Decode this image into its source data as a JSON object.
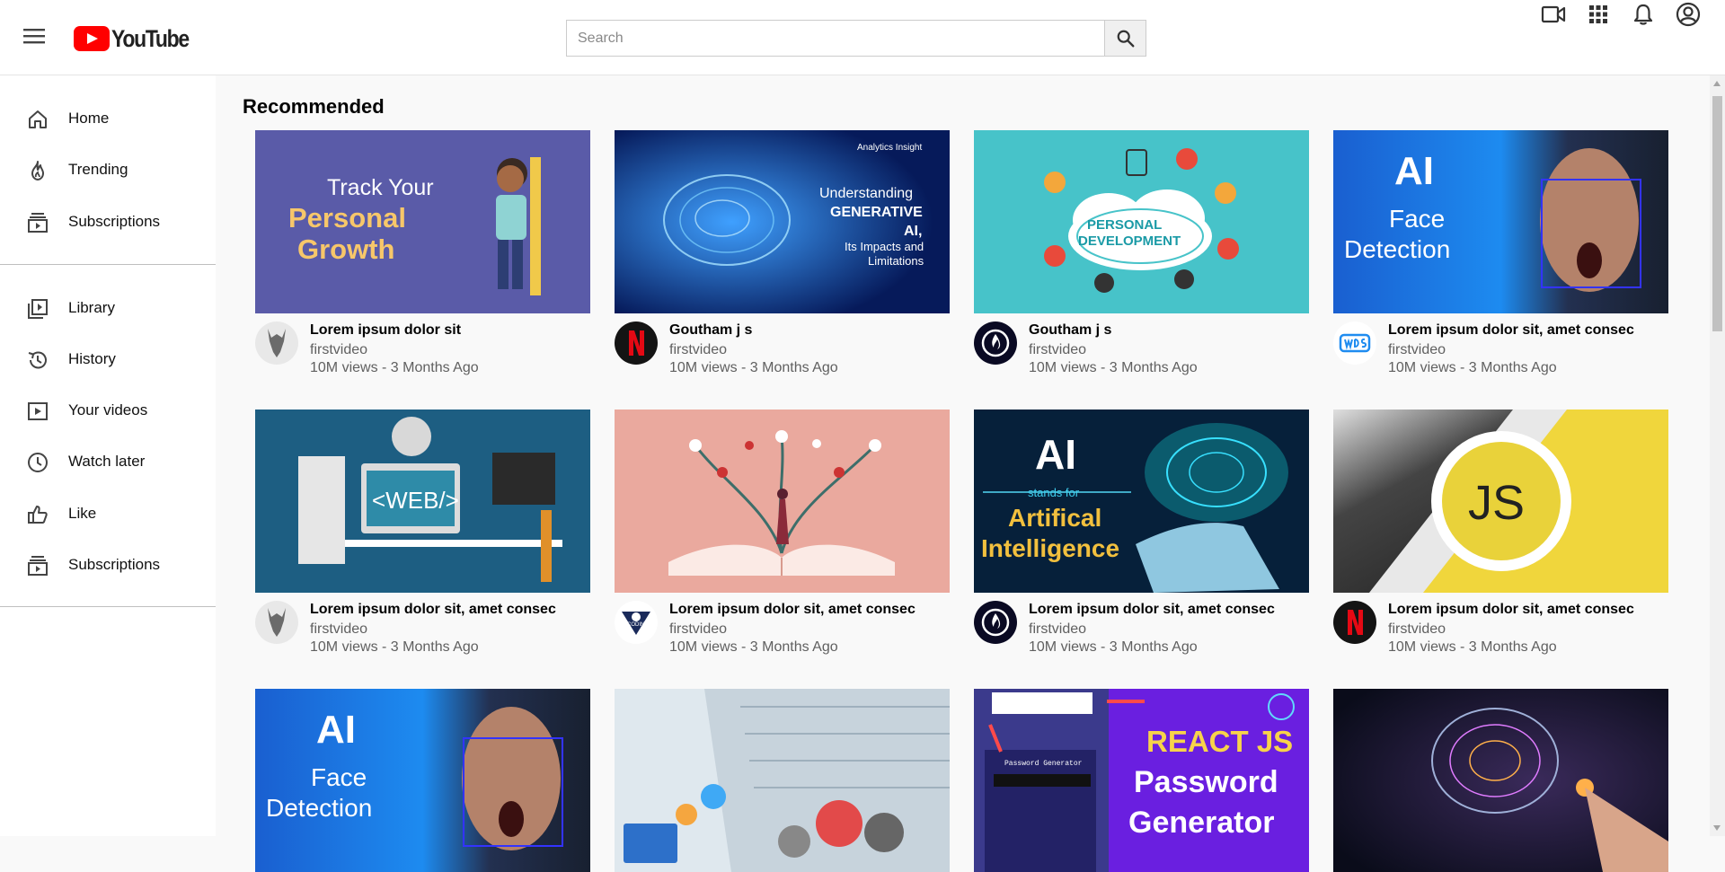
{
  "header": {
    "logo_text": "YouTube",
    "search_placeholder": "Search"
  },
  "sidebar": {
    "items": [
      {
        "label": "Home",
        "icon": "home-icon"
      },
      {
        "label": "Trending",
        "icon": "trending-icon"
      },
      {
        "label": "Subscriptions",
        "icon": "subscriptions-icon"
      },
      {
        "label": "Library",
        "icon": "library-icon"
      },
      {
        "label": "History",
        "icon": "history-icon"
      },
      {
        "label": "Your videos",
        "icon": "your-videos-icon"
      },
      {
        "label": "Watch later",
        "icon": "watch-later-icon"
      },
      {
        "label": "Like",
        "icon": "like-icon"
      },
      {
        "label": "Subscriptions",
        "icon": "subscriptions-icon"
      }
    ]
  },
  "main": {
    "section_title": "Recommended",
    "videos": [
      {
        "title": "Lorem ipsum dolor sit",
        "channel": "firstvideo",
        "meta": "10M views - 3 Months Ago",
        "thumb_text": [
          "Track Your",
          "Personal",
          "Growth"
        ]
      },
      {
        "title": "Goutham j s",
        "channel": "firstvideo",
        "meta": "10M views - 3 Months Ago",
        "thumb_text": [
          "Analytics Insight",
          "Understanding",
          "GENERATIVE",
          "AI,",
          "Its Impacts and",
          "Limitations"
        ]
      },
      {
        "title": "Goutham j s",
        "channel": "firstvideo",
        "meta": "10M views - 3 Months Ago",
        "thumb_text": [
          "PERSONAL",
          "DEVELOPMENT"
        ]
      },
      {
        "title": "Lorem ipsum dolor sit, amet consec",
        "channel": "firstvideo",
        "meta": "10M views - 3 Months Ago",
        "thumb_text": [
          "AI",
          "Face",
          "Detection"
        ]
      },
      {
        "title": "Lorem ipsum dolor sit, amet consec",
        "channel": "firstvideo",
        "meta": "10M views - 3 Months Ago",
        "thumb_text": [
          "<WEB/>"
        ]
      },
      {
        "title": "Lorem ipsum dolor sit, amet consec",
        "channel": "firstvideo",
        "meta": "10M views - 3 Months Ago",
        "thumb_text": []
      },
      {
        "title": "Lorem ipsum dolor sit, amet consec",
        "channel": "firstvideo",
        "meta": "10M views - 3 Months Ago",
        "thumb_text": [
          "AI",
          "stands for",
          "Artifical",
          "Intelligence"
        ]
      },
      {
        "title": "Lorem ipsum dolor sit, amet consec",
        "channel": "firstvideo",
        "meta": "10M views - 3 Months Ago",
        "thumb_text": [
          "JS"
        ]
      },
      {
        "title": "",
        "channel": "",
        "meta": "",
        "thumb_text": [
          "AI",
          "Face",
          "Detection"
        ]
      },
      {
        "title": "",
        "channel": "",
        "meta": "",
        "thumb_text": []
      },
      {
        "title": "",
        "channel": "",
        "meta": "",
        "thumb_text": [
          "REACT JS",
          "Password",
          "Generator",
          "Password Generator"
        ]
      },
      {
        "title": "",
        "channel": "",
        "meta": "",
        "thumb_text": []
      }
    ]
  },
  "colors": {
    "brand_red": "#ff0000",
    "text_secondary": "#606060",
    "page_bg": "#f9f9f9"
  }
}
